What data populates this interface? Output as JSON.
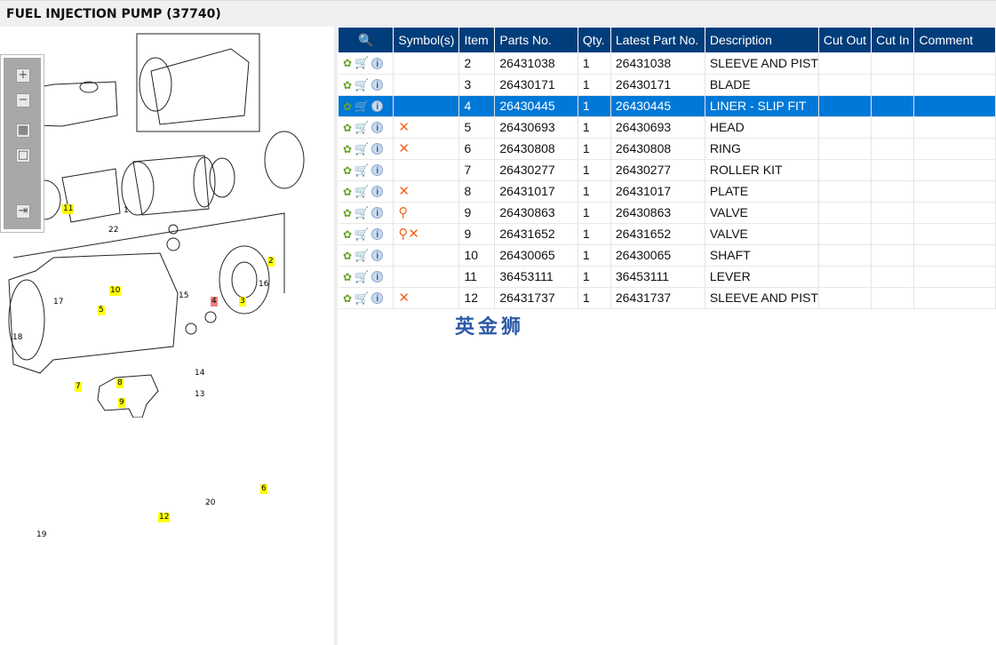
{
  "title": "FUEL INJECTION PUMP (37740)",
  "toolbar": {
    "zoom_in": "+",
    "zoom_out": "−",
    "fit": "▦",
    "actual": "□",
    "export": "⇥"
  },
  "table": {
    "headers": [
      "",
      "Symbol(s)",
      "Item",
      "Parts No.",
      "Qty.",
      "Latest Part No.",
      "Description",
      "Cut Out",
      "Cut In",
      "Comment"
    ],
    "selected_index": 2,
    "rows": [
      {
        "symbols": "",
        "item": "2",
        "part": "26431038",
        "qty": "1",
        "latest": "26431038",
        "desc": "SLEEVE AND PISTO"
      },
      {
        "symbols": "",
        "item": "3",
        "part": "26430171",
        "qty": "1",
        "latest": "26430171",
        "desc": "BLADE"
      },
      {
        "symbols": "",
        "item": "4",
        "part": "26430445",
        "qty": "1",
        "latest": "26430445",
        "desc": "LINER - SLIP FIT"
      },
      {
        "symbols": "✕",
        "item": "5",
        "part": "26430693",
        "qty": "1",
        "latest": "26430693",
        "desc": "HEAD"
      },
      {
        "symbols": "✕",
        "item": "6",
        "part": "26430808",
        "qty": "1",
        "latest": "26430808",
        "desc": "RING"
      },
      {
        "symbols": "",
        "item": "7",
        "part": "26430277",
        "qty": "1",
        "latest": "26430277",
        "desc": "ROLLER KIT"
      },
      {
        "symbols": "✕",
        "item": "8",
        "part": "26431017",
        "qty": "1",
        "latest": "26431017",
        "desc": "PLATE"
      },
      {
        "symbols": "⚲",
        "item": "9",
        "part": "26430863",
        "qty": "1",
        "latest": "26430863",
        "desc": "VALVE"
      },
      {
        "symbols": "⚲✕",
        "item": "9",
        "part": "26431652",
        "qty": "1",
        "latest": "26431652",
        "desc": "VALVE"
      },
      {
        "symbols": "",
        "item": "10",
        "part": "26430065",
        "qty": "1",
        "latest": "26430065",
        "desc": "SHAFT"
      },
      {
        "symbols": "",
        "item": "11",
        "part": "36453111",
        "qty": "1",
        "latest": "36453111",
        "desc": "LEVER"
      },
      {
        "symbols": "✕",
        "item": "12",
        "part": "26431737",
        "qty": "1",
        "latest": "26431737",
        "desc": "SLEEVE AND PISTO"
      }
    ]
  },
  "icons": {
    "gear": "✿",
    "cart": "🛒",
    "info": "i",
    "header": "🔍"
  },
  "watermark": "英金狮",
  "callouts": [
    {
      "t": "11",
      "c": "y"
    },
    {
      "t": "22",
      "c": ""
    },
    {
      "t": "1",
      "c": ""
    },
    {
      "t": "2",
      "c": "y"
    },
    {
      "t": "10",
      "c": "y"
    },
    {
      "t": "15",
      "c": ""
    },
    {
      "t": "4",
      "c": "r"
    },
    {
      "t": "3",
      "c": "y"
    },
    {
      "t": "16",
      "c": ""
    },
    {
      "t": "17",
      "c": ""
    },
    {
      "t": "5",
      "c": "y"
    },
    {
      "t": "18",
      "c": ""
    },
    {
      "t": "14",
      "c": ""
    },
    {
      "t": "7",
      "c": "y"
    },
    {
      "t": "8",
      "c": "y"
    },
    {
      "t": "9",
      "c": "y"
    },
    {
      "t": "13",
      "c": ""
    },
    {
      "t": "6",
      "c": "y"
    },
    {
      "t": "20",
      "c": ""
    },
    {
      "t": "19",
      "c": ""
    },
    {
      "t": "12",
      "c": "y"
    }
  ],
  "colors": {
    "header": "#003d7a",
    "selected": "#0078d7",
    "highlight": "#ffff00",
    "current": "#f08080"
  }
}
